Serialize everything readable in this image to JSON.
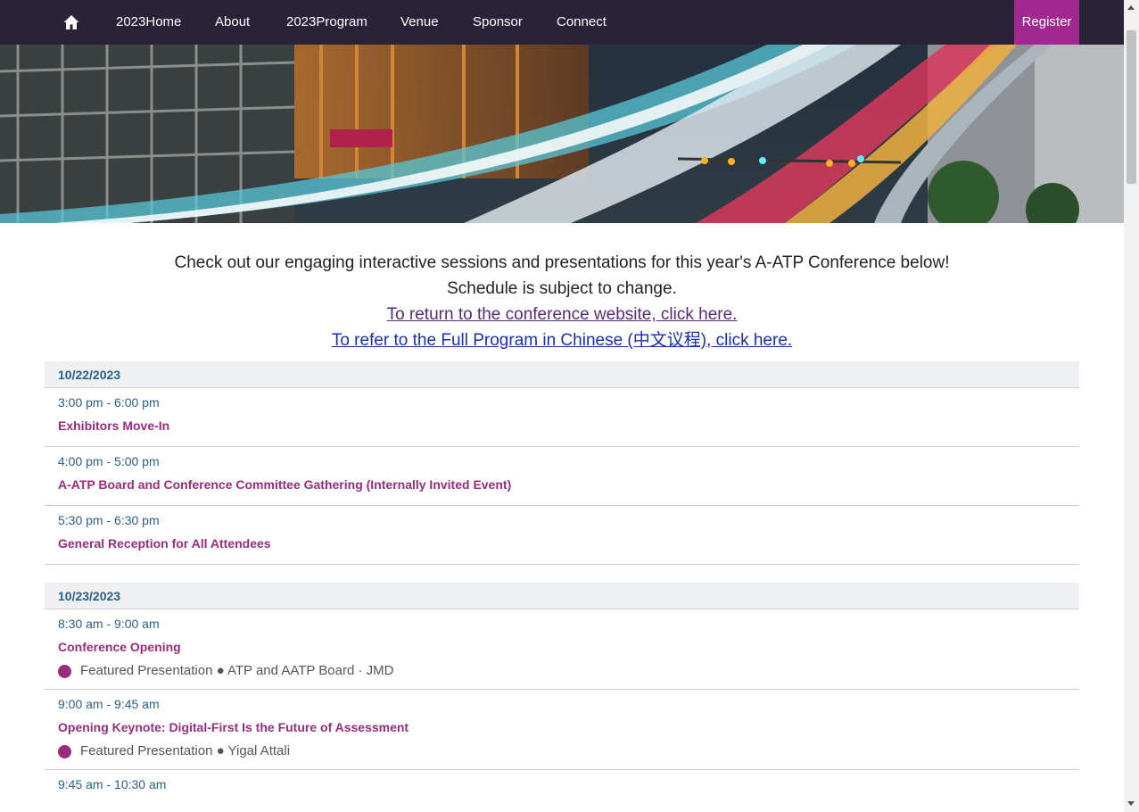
{
  "nav": {
    "items": [
      "2023Home",
      "About",
      "2023Program",
      "Venue",
      "Sponsor",
      "Connect"
    ],
    "register": "Register"
  },
  "intro": {
    "line1": "Check out our engaging interactive sessions and presentations for this year's A-ATP Conference below!",
    "line2": "Schedule is subject to change.",
    "link1": "To return to the conference website, click here.",
    "link2": "To refer to the Full Program in Chinese (中文议程), click here."
  },
  "days": [
    {
      "date": "10/22/2023",
      "sessions": [
        {
          "time": "3:00 pm - 6:00 pm",
          "title": "Exhibitors Move-In"
        },
        {
          "time": "4:00 pm - 5:00 pm",
          "title": "A-ATP Board and Conference Committee Gathering (Internally Invited Event)"
        },
        {
          "time": "5:30 pm - 6:30 pm",
          "title": "General Reception for All Attendees"
        }
      ]
    },
    {
      "date": "10/23/2023",
      "sessions": [
        {
          "time": "8:30 am - 9:00 am",
          "title": "Conference Opening",
          "meta": "Featured Presentation ● ATP and AATP Board · JMD"
        },
        {
          "time": "9:00 am - 9:45 am",
          "title": "Opening Keynote: Digital-First Is the Future of Assessment",
          "meta": "Featured Presentation ● Yigal Attali"
        },
        {
          "time": "9:45 am - 10:30 am",
          "title": ""
        }
      ]
    }
  ],
  "colors": {
    "nav_bg": "#2a2239",
    "register_bg": "#a0288f",
    "time": "#2b5f86",
    "title": "#9a2c7e",
    "day_bg": "#eef0f3"
  }
}
